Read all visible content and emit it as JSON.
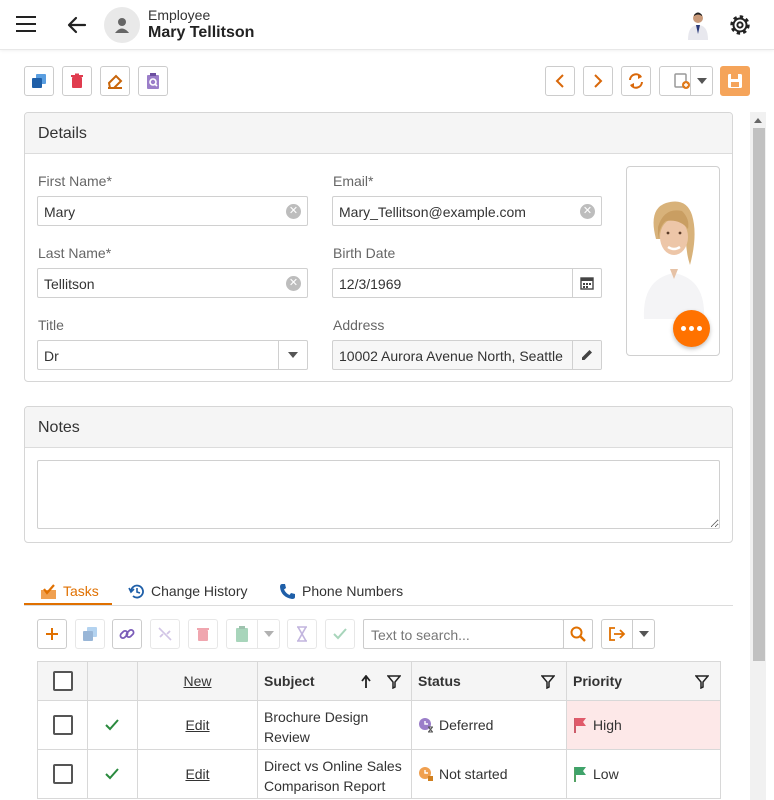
{
  "header": {
    "caption": "Employee",
    "name": "Mary Tellitson"
  },
  "details": {
    "title": "Details",
    "first_name_label": "First Name*",
    "first_name": "Mary",
    "email_label": "Email*",
    "email": "Mary_Tellitson@example.com",
    "last_name_label": "Last Name*",
    "last_name": "Tellitson",
    "birth_date_label": "Birth Date",
    "birth_date": "12/3/1969",
    "title_label": "Title",
    "title_value": "Dr",
    "address_label": "Address",
    "address": "10002 Aurora Avenue North, Seattle"
  },
  "notes": {
    "title": "Notes",
    "value": ""
  },
  "tabs": [
    {
      "label": "Tasks",
      "icon": "tasks-icon",
      "active": true
    },
    {
      "label": "Change History",
      "icon": "history-icon",
      "active": false
    },
    {
      "label": "Phone Numbers",
      "icon": "phone-icon",
      "active": false
    }
  ],
  "grid_toolbar": {
    "search_placeholder": "Text to search..."
  },
  "grid": {
    "columns": {
      "new": "New",
      "subject": "Subject",
      "status": "Status",
      "priority": "Priority"
    },
    "rows": [
      {
        "edit": "Edit",
        "subject": "Brochure Design Review",
        "status": "Deferred",
        "priority": "High",
        "completed": true
      },
      {
        "edit": "Edit",
        "subject": "Direct vs Online Sales Comparison Report",
        "status": "Not started",
        "priority": "Low",
        "completed": true
      }
    ]
  },
  "colors": {
    "accent": "#e07000",
    "fab": "#ff7200",
    "save_button": "#f5a45a",
    "high_priority_bg": "#fde8e8",
    "high_flag": "#e05a6a",
    "low_flag": "#3fa36a",
    "check_green": "#2a8a3e"
  }
}
